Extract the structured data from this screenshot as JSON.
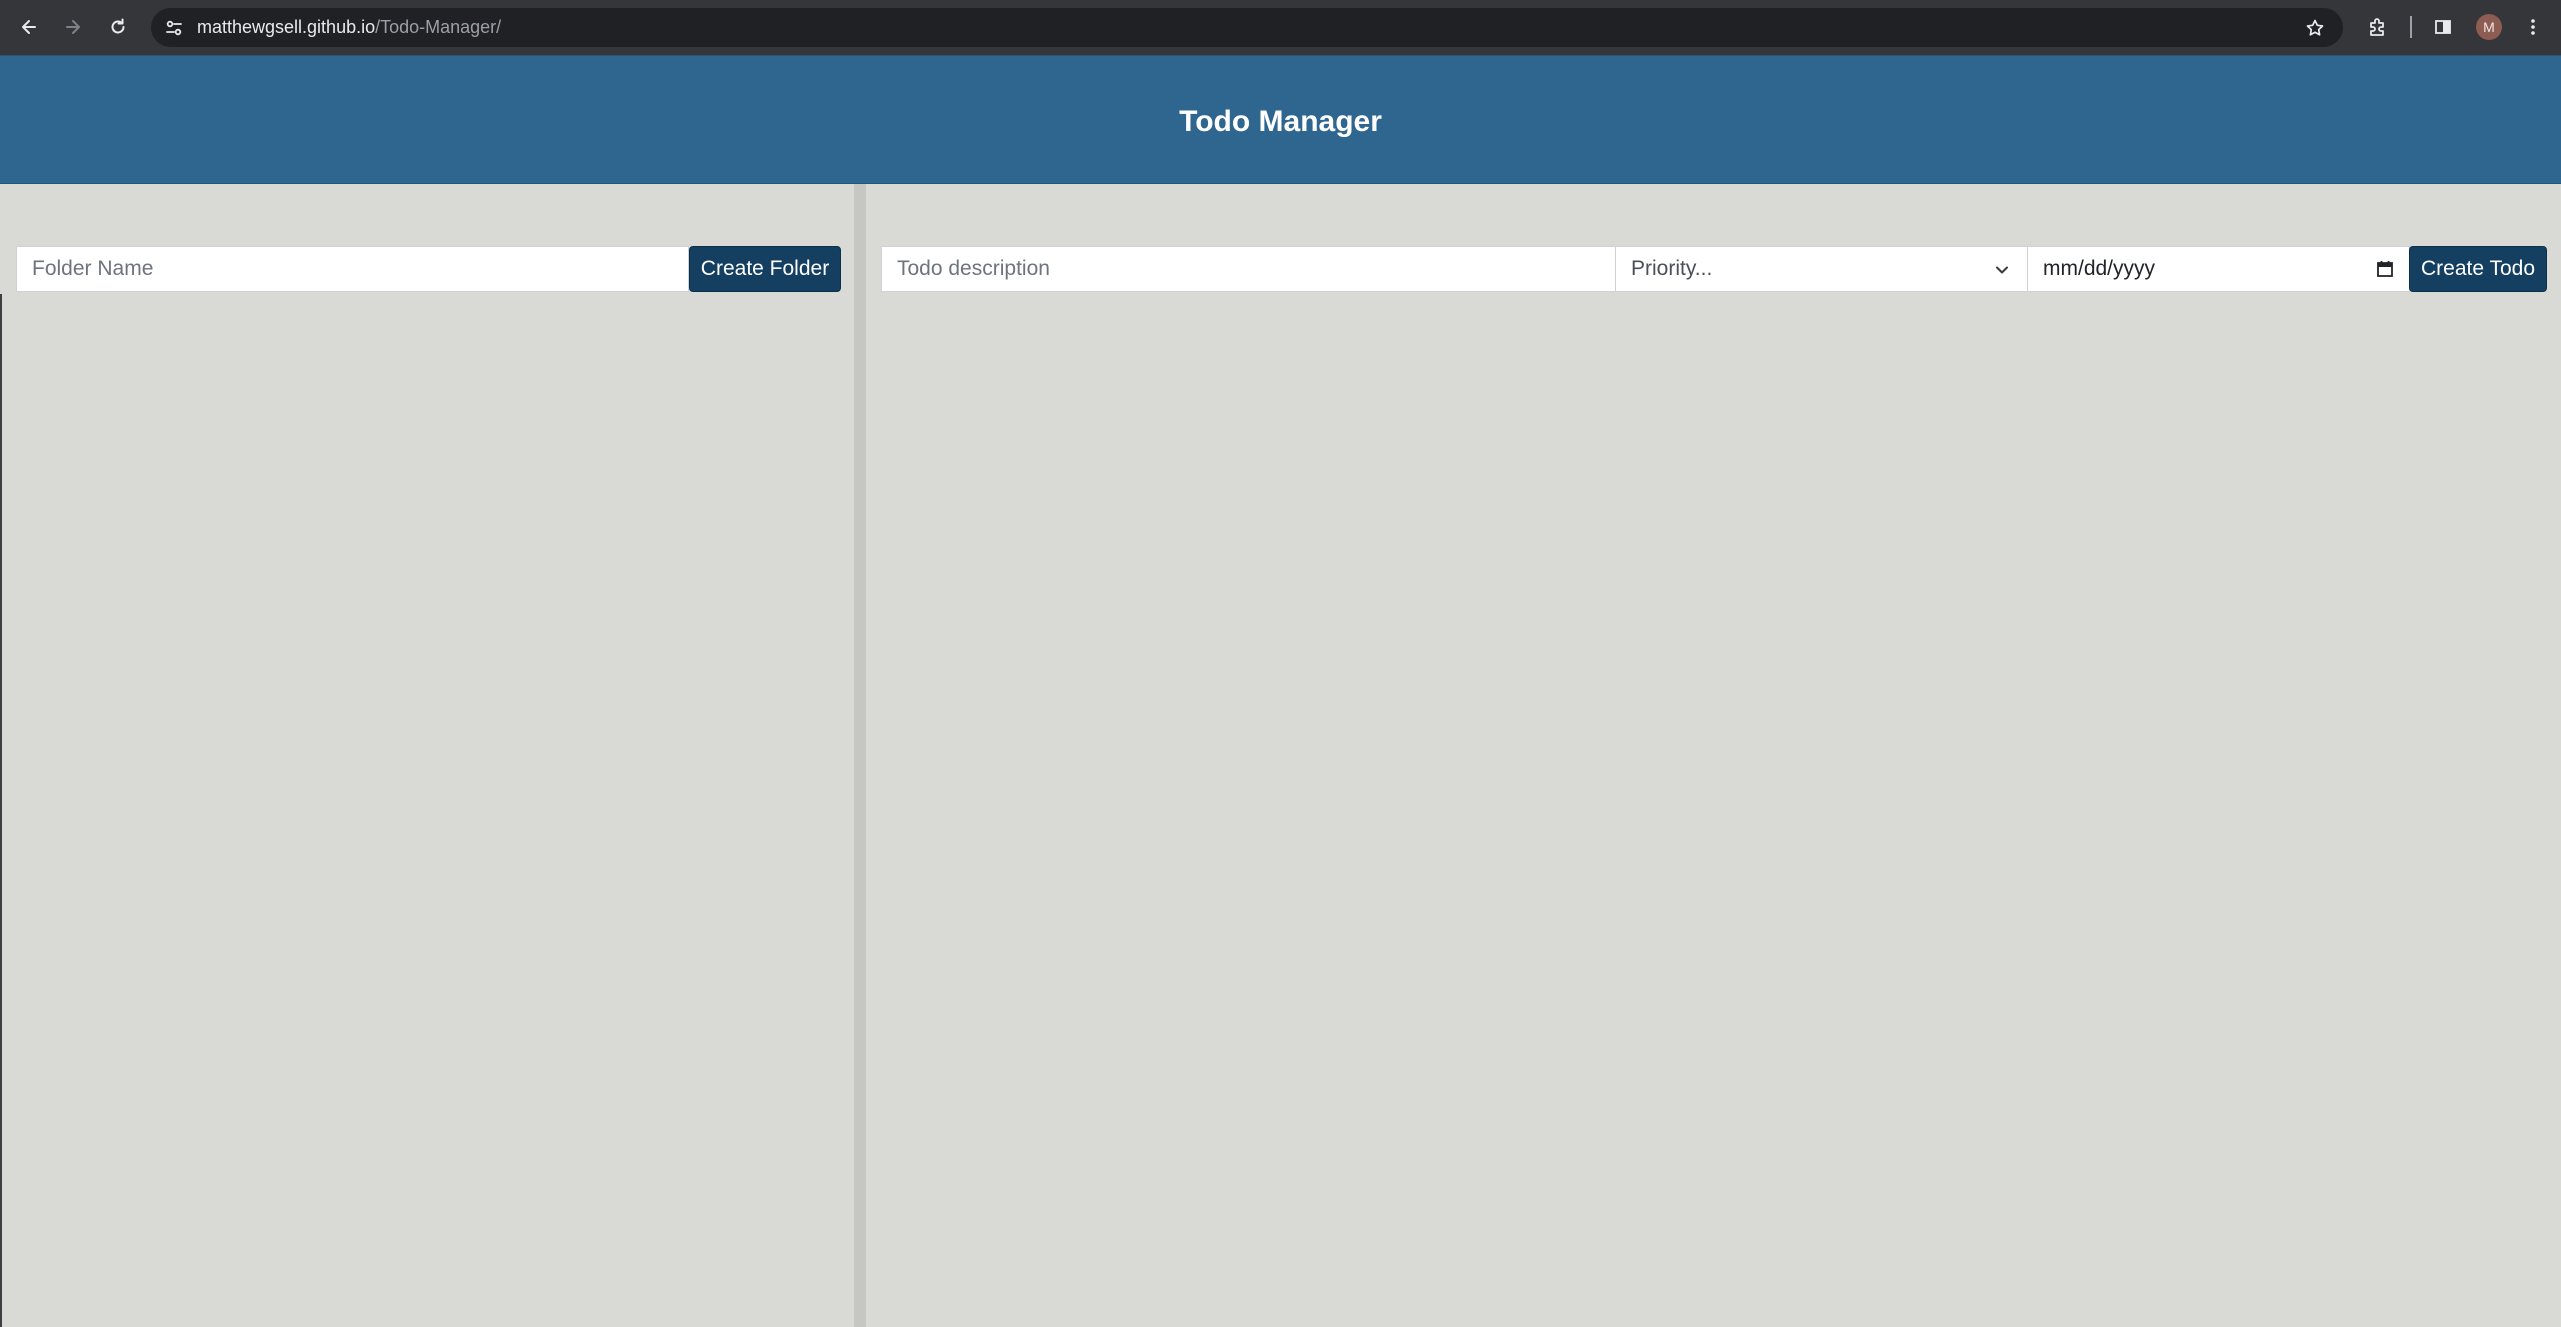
{
  "browser": {
    "url_host": "matthewgsell.github.io",
    "url_path": "/Todo-Manager/",
    "avatar_letter": "M",
    "icons": [
      "back-arrow-icon",
      "forward-arrow-icon",
      "reload-icon",
      "site-info-icon",
      "bookmark-star-icon",
      "extensions-icon",
      "side-panel-icon",
      "kebab-menu-icon"
    ]
  },
  "header": {
    "title": "Todo Manager",
    "color": "#2e6690"
  },
  "folders": {
    "name_placeholder": "Folder Name",
    "create_label": "Create Folder"
  },
  "todos": {
    "description_placeholder": "Todo description",
    "priority_selected": "Priority...",
    "date_value": "mm/dd/yyyy",
    "create_label": "Create Todo"
  },
  "colors": {
    "button": "#143f61",
    "background": "#d9dad6"
  }
}
